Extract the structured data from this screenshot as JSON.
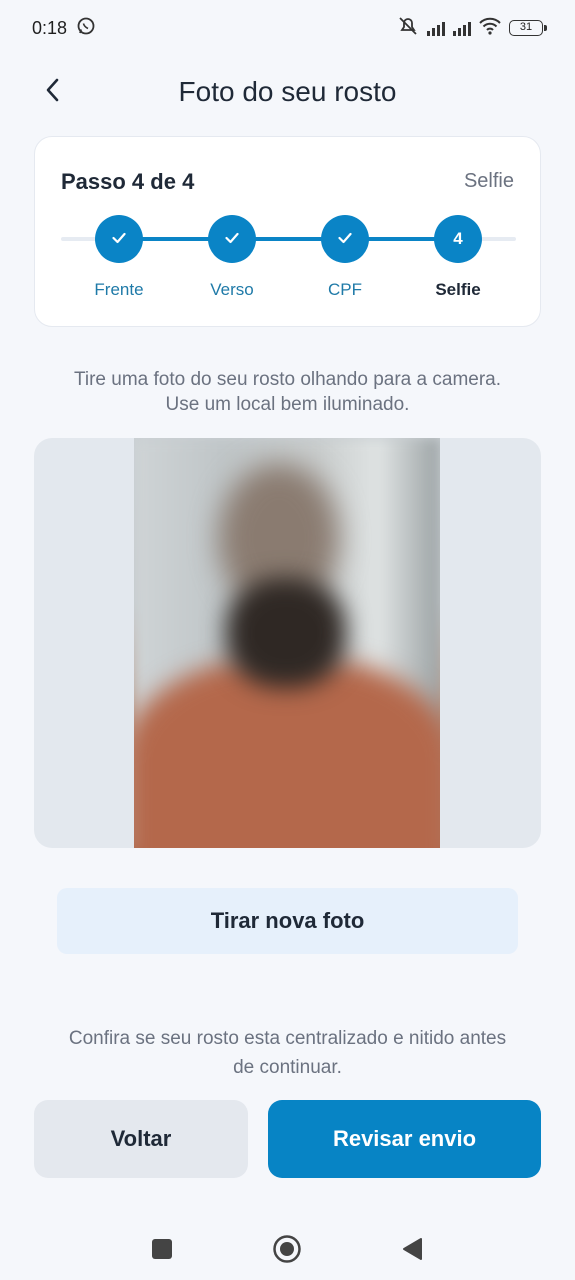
{
  "status_bar": {
    "time": "0:18",
    "battery": "31",
    "icons": [
      "whatsapp-icon",
      "mute-icon",
      "signal-icon",
      "signal-icon",
      "wifi-icon",
      "battery-icon"
    ]
  },
  "header": {
    "title": "Foto do seu rosto",
    "back_icon": "chevron-left-icon"
  },
  "stepper": {
    "title": "Passo 4 de 4",
    "current_label": "Selfie",
    "progress": 1.0,
    "steps": [
      {
        "label": "Frente",
        "state": "done",
        "icon": "check-icon"
      },
      {
        "label": "Verso",
        "state": "done",
        "icon": "check-icon"
      },
      {
        "label": "CPF",
        "state": "done",
        "icon": "check-icon"
      },
      {
        "label": "Selfie",
        "state": "active",
        "number": "4"
      }
    ]
  },
  "instruction": {
    "line1": "Tire uma foto do seu rosto olhando para a camera.",
    "line2": "Use um local bem iluminado."
  },
  "retake_label": "Tirar nova foto",
  "hint": {
    "line1": "Confira se seu rosto esta centralizado e nitido antes",
    "line2": "de continuar."
  },
  "actions": {
    "back_label": "Voltar",
    "primary_label": "Revisar envio"
  },
  "colors": {
    "accent": "#0a84c6",
    "background": "#f5f7fb",
    "secondary_button": "#e4e8ee",
    "retake_button": "#e6f0fb"
  },
  "navbar": [
    "recents-icon",
    "home-icon",
    "back-icon"
  ]
}
